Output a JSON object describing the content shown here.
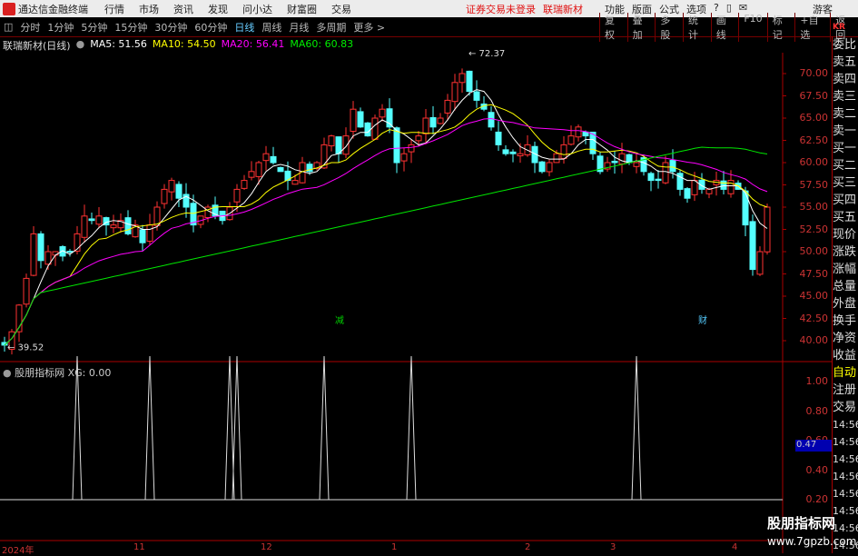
{
  "app": {
    "title": "通达信金融终端",
    "menu": [
      "行情",
      "市场",
      "资讯",
      "发现",
      "问小达",
      "财富圈",
      "交易"
    ],
    "status": [
      "证券交易未登录",
      "联瑞新材"
    ],
    "right_menu": [
      "功能",
      "版面",
      "公式",
      "选项"
    ],
    "guest": "游客"
  },
  "toolbar": {
    "periods": [
      "分时",
      "1分钟",
      "5分钟",
      "15分钟",
      "30分钟",
      "60分钟",
      "日线",
      "周线",
      "月线",
      "多周期",
      "更多 >"
    ],
    "active_period": "日线",
    "tools": [
      "复权",
      "叠加",
      "多股",
      "统计",
      "画线",
      "F10",
      "标记",
      "+自选",
      "返回"
    ],
    "kr": "KR"
  },
  "info": {
    "stock": "联瑞新材(日线)",
    "ma5": "MA5: 51.56",
    "ma10": "MA10: 54.50",
    "ma20": "MA20: 56.41",
    "ma60": "MA60: 60.83"
  },
  "colors": {
    "up": "#ff3232",
    "down": "#54ffff",
    "ma5": "#ffffff",
    "ma10": "#ffff00",
    "ma20": "#ff00ff",
    "ma60": "#00e600"
  },
  "chart_data": {
    "type": "candlestick",
    "price_ticks": [
      "70.00",
      "67.50",
      "65.00",
      "62.50",
      "60.00",
      "57.50",
      "55.00",
      "52.50",
      "50.00",
      "47.50",
      "45.00",
      "42.50",
      "40.00"
    ],
    "closes": [
      39.5,
      41,
      44,
      47,
      52,
      49,
      50,
      50,
      49.5,
      50,
      52,
      54,
      53.5,
      54,
      53,
      53,
      53.5,
      52,
      53,
      51,
      53,
      55,
      57,
      58,
      56,
      55,
      53,
      54,
      55,
      54,
      53.5,
      55,
      57,
      58,
      59,
      60,
      61,
      60,
      59,
      58,
      58,
      60,
      59,
      60,
      62,
      63,
      61,
      63,
      66,
      64,
      63,
      65,
      66,
      64,
      60,
      61,
      62,
      63,
      65,
      64,
      65,
      67,
      69,
      70,
      68,
      67,
      66,
      64,
      62,
      61,
      61,
      61,
      62,
      60,
      59,
      60,
      61,
      62,
      63,
      64,
      63,
      61,
      59,
      60,
      60,
      61,
      60,
      60,
      59,
      58,
      58,
      60,
      59,
      57,
      56,
      58,
      57,
      57,
      58,
      57,
      58,
      57,
      53,
      48,
      50,
      55
    ],
    "high_label": "72.37",
    "low_label": "39.52",
    "markers": [
      {
        "label": "减",
        "index": 46
      },
      {
        "label": "财",
        "index": 96
      }
    ],
    "indicator": {
      "name": "股朋指标网",
      "value_text": "XG: 0.00",
      "ticks": [
        "1.00",
        "0.80",
        "0.60",
        "0.40",
        "0.20"
      ],
      "current": "0.47",
      "signal_indices": [
        10,
        20,
        31,
        32,
        44,
        56,
        87
      ]
    },
    "date_labels": [
      "2024年",
      "11",
      "12",
      "1",
      "2",
      "3",
      "4"
    ]
  },
  "rightpanel": [
    "委比",
    "卖五",
    "卖四",
    "卖三",
    "卖二",
    "卖一",
    "买一",
    "买二",
    "买三",
    "买四",
    "买五",
    "现价",
    "涨跌",
    "涨幅",
    "总量",
    "外盘",
    "换手",
    "净资",
    "收益",
    "自动",
    "注册",
    "交易",
    "14:56",
    "14:56",
    "14:56",
    "14:56",
    "14:56",
    "14:56",
    "14:56",
    "14:56"
  ],
  "watermark": {
    "name": "股朋指标网",
    "url": "www.7gpzb.com"
  }
}
